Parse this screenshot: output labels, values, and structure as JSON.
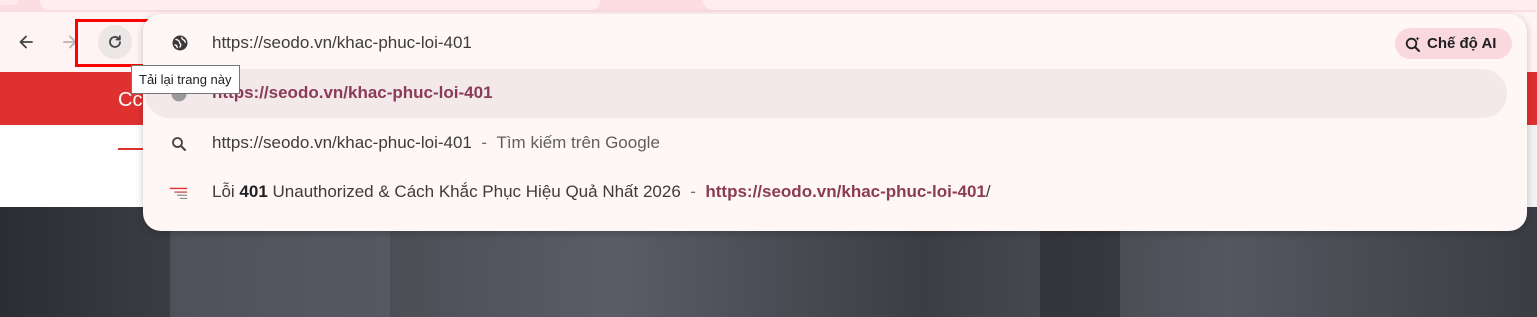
{
  "browser": {
    "tooltip": "Tải lại trang này",
    "address_bar": {
      "url": "https://seodo.vn/khac-phuc-loi-401",
      "ai_mode_label": "Chế độ AI"
    }
  },
  "background_page": {
    "banner_text": "Cc"
  },
  "suggestions": [
    {
      "icon": "globe-icon",
      "url": "https://seodo.vn/khac-phuc-loi-401"
    },
    {
      "icon": "search-icon",
      "query": "https://seodo.vn/khac-phuc-loi-401",
      "separator": "-",
      "description": "Tìm kiếm trên Google"
    },
    {
      "icon": "site-favicon-icon",
      "title_prefix": "Lỗi ",
      "title_bold": "401",
      "title_rest": " Unauthorized & Cách Khắc Phục Hiệu Quả Nhất 2026",
      "separator": "-",
      "url_bold": "https://seodo.vn/khac-phuc-loi-401",
      "url_tail": "/"
    }
  ],
  "colors": {
    "accent_red": "#e03131",
    "highlight_box": "#ff0000",
    "url_match": "#8a3b55",
    "ai_chip_bg": "#f9d9de"
  }
}
